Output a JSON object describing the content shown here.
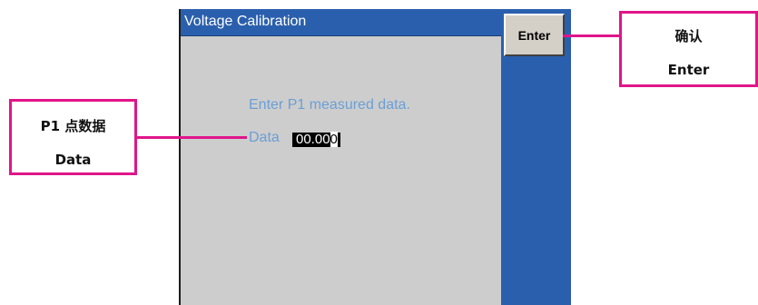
{
  "window": {
    "title": "Voltage  Calibration"
  },
  "buttons": {
    "enter_label": "Enter"
  },
  "content": {
    "prompt": "Enter P1 measured data.",
    "data_label": "Data",
    "data_value": "00.00",
    "data_value_cursor": "0"
  },
  "annotations": {
    "left": {
      "line1": "P1 点数据",
      "line2": "Data"
    },
    "right": {
      "line1": "确认",
      "line2": "Enter"
    }
  },
  "colors": {
    "titlebar": "#2a5fad",
    "screen_bg": "#cdcdcd",
    "text_blue": "#6a9fd6",
    "callout_border": "#e0158a"
  }
}
